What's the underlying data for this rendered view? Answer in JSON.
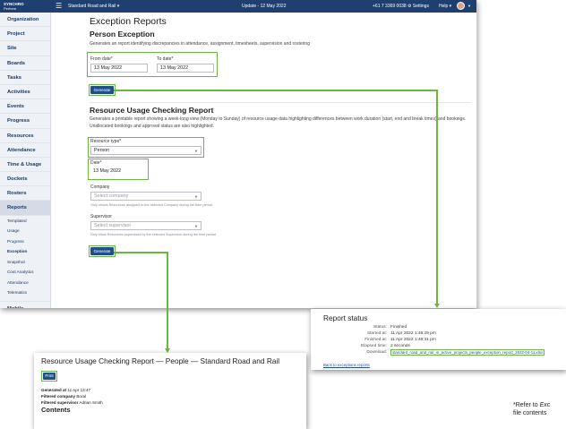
{
  "topbar": {
    "logo_brand": "SYNCHRO",
    "logo_product": "Perform",
    "project": "Standard Road and Rail ▾",
    "update": "Update - 12 May 2022",
    "phone": "+61 7 3369 0038",
    "settings": "⚙ Settings",
    "help": "Help ▾"
  },
  "sidebar": {
    "items": [
      "Organization",
      "Project",
      "Site",
      "Boards",
      "Tasks",
      "Activities",
      "Events",
      "Progress",
      "Resources",
      "Attendance",
      "Time & Usage",
      "Dockets",
      "Rosters",
      "Reports"
    ],
    "active": "Reports",
    "sub_items": [
      "Templated",
      "Usage",
      "Progress",
      "Exception",
      "Snapshot",
      "Cost Analytics",
      "Attendance",
      "Telematics"
    ],
    "sub_active": "Exception",
    "bottom_item": "Mobile"
  },
  "page": {
    "title": "Exception Reports",
    "person_exception": {
      "heading": "Person Exception",
      "description": "Generates an report identifying discrepancies in attendance, assignment, timesheets, supervision and rostering",
      "from_label": "From date*",
      "from_value": "13 May 2022",
      "to_label": "To date*",
      "to_value": "13 May 2022",
      "generate": "Generate"
    },
    "usage_report": {
      "heading": "Resource Usage Checking Report",
      "description": "Generates a printable report showing a week-long view (Monday to Sunday) of resource usage data highlighting differences between work duration (start, end and break times) and bookings. Unallocated bookings and approval status are also highlighted.",
      "resource_type_label": "Resource type*",
      "resource_type_value": "Person",
      "date_label": "Date*",
      "date_value": "13 May 2022",
      "company_label": "Company",
      "company_placeholder": "Select company",
      "company_hint": "Only shows Resources assigned to the selected Company during the time period",
      "supervisor_label": "Supervisor",
      "supervisor_placeholder": "Select supervisor",
      "supervisor_hint": "Only show Resources supervised by the selected Supervisor during the time period",
      "generate": "Generate"
    }
  },
  "status": {
    "title": "Report status",
    "rows": [
      {
        "key": "Status:",
        "value": "Finished"
      },
      {
        "key": "Started at:",
        "value": "11 Apr 2022 1:48:29 pm"
      },
      {
        "key": "Finished at:",
        "value": "11 Apr 2022 1:48:31 pm"
      },
      {
        "key": "Elapsed time:",
        "value": "2 seconds"
      },
      {
        "key": "Download:",
        "value": "standard_road_and_rail_in_active_projects_people_exception_report_2022-04-11.xlsx"
      }
    ],
    "back_link": "Back to exceptions reports"
  },
  "printable": {
    "title": "Resource Usage Checking Report — People — Standard Road and Rail",
    "print": "Print",
    "generated_key": "Generated at",
    "generated_val": "11 Apr 13:47",
    "company_key": "Filtered company",
    "company_val": "Boral",
    "supervisor_key": "Filtered supervisor",
    "supervisor_val": "Adrian Smith",
    "contents": "Contents"
  },
  "note": {
    "line1_prefix": "*Refer to ",
    "line1_italic": "Exc",
    "line2": "file contents"
  },
  "colors": {
    "header": "#1f3f6e",
    "button": "#1f4f8a",
    "highlight": "#6ab83e",
    "sidebar": "#eef1f5"
  }
}
